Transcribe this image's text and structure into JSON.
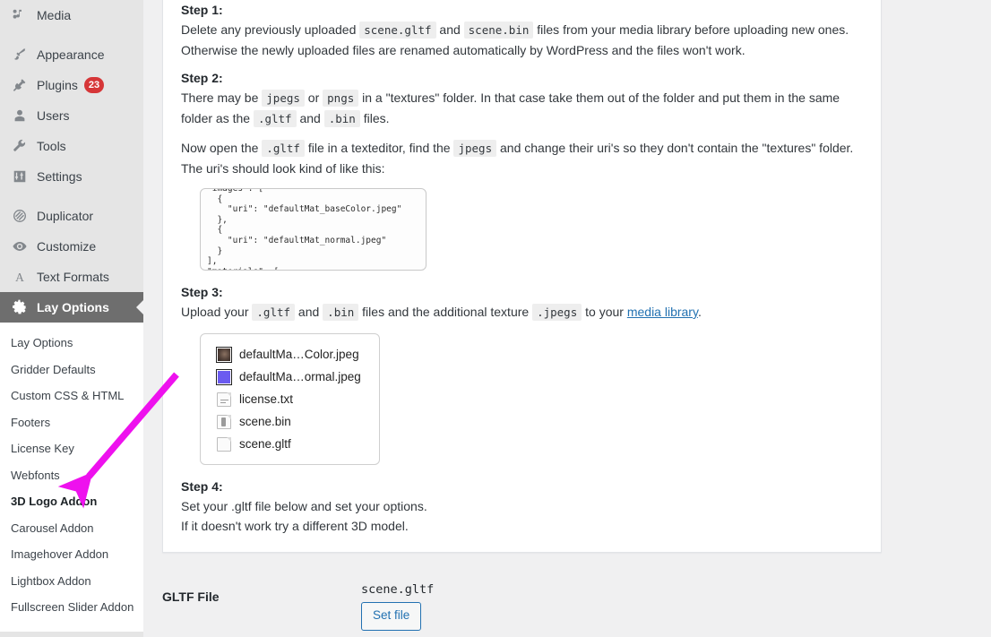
{
  "colors": {
    "accent_link": "#2271b1",
    "badge_red": "#d63638",
    "active_menu_bg": "#6e6e6e",
    "arrow_magenta": "#ee11ee",
    "page_bg": "#f0f0f1",
    "sidebar_bg": "#e5e5e5"
  },
  "sidebar": {
    "top_items": [
      {
        "label": "Media",
        "icon": "media-icon",
        "badge": null,
        "current": false,
        "sep_after": true
      },
      {
        "label": "Appearance",
        "icon": "appearance-brush-icon",
        "badge": null,
        "current": false,
        "sep_after": false
      },
      {
        "label": "Plugins",
        "icon": "plugins-plug-icon",
        "badge": "23",
        "current": false,
        "sep_after": false
      },
      {
        "label": "Users",
        "icon": "users-person-icon",
        "badge": null,
        "current": false,
        "sep_after": false
      },
      {
        "label": "Tools",
        "icon": "tools-wrench-icon",
        "badge": null,
        "current": false,
        "sep_after": false
      },
      {
        "label": "Settings",
        "icon": "settings-sliders-icon",
        "badge": null,
        "current": false,
        "sep_after": true
      },
      {
        "label": "Duplicator",
        "icon": "duplicator-icon",
        "badge": null,
        "current": false,
        "sep_after": false
      },
      {
        "label": "Customize",
        "icon": "customize-eye-icon",
        "badge": null,
        "current": false,
        "sep_after": false
      },
      {
        "label": "Text Formats",
        "icon": "text-formats-a-icon",
        "badge": null,
        "current": false,
        "sep_after": false
      },
      {
        "label": "Lay Options",
        "icon": "gear-icon",
        "badge": null,
        "current": true,
        "sep_after": false
      }
    ],
    "submenu": [
      {
        "label": "Lay Options",
        "current": false
      },
      {
        "label": "Gridder Defaults",
        "current": false
      },
      {
        "label": "Custom CSS & HTML",
        "current": false
      },
      {
        "label": "Footers",
        "current": false
      },
      {
        "label": "License Key",
        "current": false
      },
      {
        "label": "Webfonts",
        "current": false
      },
      {
        "label": "3D Logo Addon",
        "current": true
      },
      {
        "label": "Carousel Addon",
        "current": false
      },
      {
        "label": "Imagehover Addon",
        "current": false
      },
      {
        "label": "Lightbox Addon",
        "current": false
      },
      {
        "label": "Fullscreen Slider Addon",
        "current": false
      }
    ]
  },
  "instructions": {
    "step1": {
      "heading": "Step 1:",
      "line1_a": "Delete any previously uploaded ",
      "code1": "scene.gltf",
      "line1_b": " and ",
      "code2": "scene.bin",
      "line1_c": " files from your media library before uploading new ones.",
      "line2": "Otherwise the newly uploaded files are renamed automatically by WordPress and the files won't work."
    },
    "step2": {
      "heading": "Step 2:",
      "p1_a": "There may be ",
      "p1_code1": "jpegs",
      "p1_b": " or ",
      "p1_code2": "pngs",
      "p1_c": " in a \"textures\" folder. In that case take them out of the folder and put them in the same folder as the ",
      "p1_code3": ".gltf",
      "p1_d": " and ",
      "p1_code4": ".bin",
      "p1_e": " files.",
      "p2_a": "Now open the ",
      "p2_code1": ".gltf",
      "p2_b": " file in a texteditor, find the ",
      "p2_code2": "jpegs",
      "p2_c": " and change their uri's so they don't contain the \"textures\" folder. The uri's should look kind of like this:",
      "code_block": "\"images\": [\n  {\n    \"uri\": \"defaultMat_baseColor.jpeg\"\n  },\n  {\n    \"uri\": \"defaultMat_normal.jpeg\"\n  }\n],\n\"materials\": ["
    },
    "step3": {
      "heading": "Step 3:",
      "a": "Upload your ",
      "code1": ".gltf",
      "b": " and ",
      "code2": ".bin",
      "c": " files and the additional texture ",
      "code3": ".jpegs",
      "d": " to your ",
      "link": "media library",
      "e": "."
    },
    "step4": {
      "heading": "Step 4:",
      "line1": "Set your .gltf file below and set your options.",
      "line2": "If it doesn't work try a different 3D model."
    }
  },
  "file_list": [
    {
      "name": "defaultMa…Color.jpeg",
      "icon": "image-thumbnail-dark-icon"
    },
    {
      "name": "defaultMa…ormal.jpeg",
      "icon": "image-thumbnail-blue-icon"
    },
    {
      "name": "license.txt",
      "icon": "text-document-icon"
    },
    {
      "name": "scene.bin",
      "icon": "binary-document-icon"
    },
    {
      "name": "scene.gltf",
      "icon": "blank-document-icon"
    }
  ],
  "gltf_field": {
    "label": "GLTF File",
    "value": "scene.gltf",
    "button_label": "Set file"
  },
  "annotation": {
    "arrow": "magenta-arrow-pointing-to-3d-logo-addon"
  }
}
